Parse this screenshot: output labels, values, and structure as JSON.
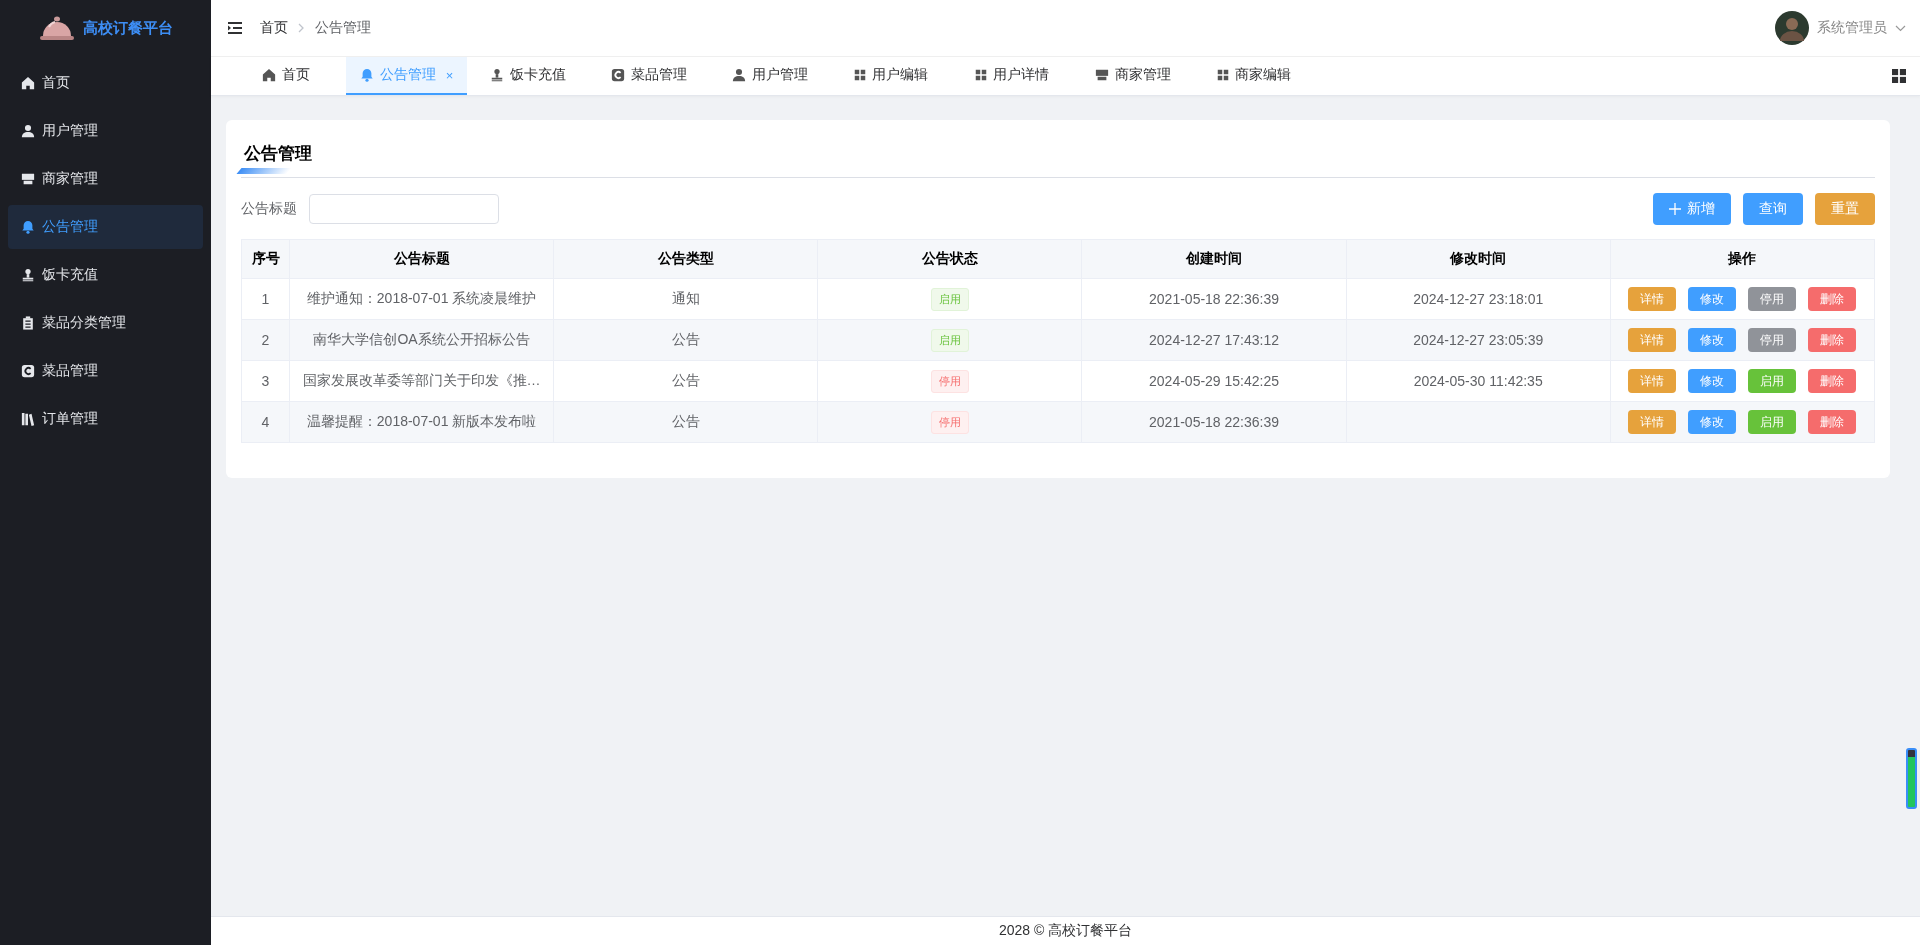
{
  "sidebar": {
    "brand": "高校订餐平台",
    "items": [
      {
        "label": "首页",
        "selected": false
      },
      {
        "label": "用户管理",
        "selected": false
      },
      {
        "label": "商家管理",
        "selected": false
      },
      {
        "label": "公告管理",
        "selected": true
      },
      {
        "label": "饭卡充值",
        "selected": false
      },
      {
        "label": "菜品分类管理",
        "selected": false
      },
      {
        "label": "菜品管理",
        "selected": false
      },
      {
        "label": "订单管理",
        "selected": false
      }
    ]
  },
  "header": {
    "breadcrumb": [
      "首页",
      "公告管理"
    ],
    "user_name": "系统管理员"
  },
  "tabs": [
    {
      "label": "首页",
      "selected": false
    },
    {
      "label": "公告管理",
      "selected": true,
      "close": "×"
    },
    {
      "label": "饭卡充值",
      "selected": false
    },
    {
      "label": "菜品管理",
      "selected": false
    },
    {
      "label": "用户管理",
      "selected": false
    },
    {
      "label": "用户编辑",
      "selected": false
    },
    {
      "label": "用户详情",
      "selected": false
    },
    {
      "label": "商家管理",
      "selected": false
    },
    {
      "label": "商家编辑",
      "selected": false
    }
  ],
  "panel": {
    "title": "公告管理",
    "search": {
      "label": "公告标题"
    },
    "buttons": [
      {
        "label": "新增",
        "kind": "add"
      },
      {
        "label": "查询",
        "kind": "query"
      },
      {
        "label": "重置",
        "kind": "reset"
      }
    ],
    "table": {
      "columns": [
        "序号",
        "公告标题",
        "公告类型",
        "公告状态",
        "创建时间",
        "修改时间",
        "操作"
      ],
      "rows": [
        {
          "index": "1",
          "title": "维护通知：2018-07-01 系统凌晨维护",
          "type": "通知",
          "status": {
            "label": "启用",
            "enabled": true
          },
          "created": "2021-05-18 22:36:39",
          "modified": "2024-12-27 23:18:01",
          "actions": [
            {
              "label": "详情",
              "kind": "detail"
            },
            {
              "label": "修改",
              "kind": "edit"
            },
            {
              "label": "停用",
              "kind": "disable"
            },
            {
              "label": "删除",
              "kind": "delete"
            }
          ]
        },
        {
          "index": "2",
          "title": "南华大学信创OA系统公开招标公告",
          "type": "公告",
          "status": {
            "label": "启用",
            "enabled": true
          },
          "created": "2024-12-27 17:43:12",
          "modified": "2024-12-27 23:05:39",
          "actions": [
            {
              "label": "详情",
              "kind": "detail"
            },
            {
              "label": "修改",
              "kind": "edit"
            },
            {
              "label": "停用",
              "kind": "disable"
            },
            {
              "label": "删除",
              "kind": "delete"
            }
          ]
        },
        {
          "index": "3",
          "title": "国家发展改革委等部门关于印发《推…",
          "type": "公告",
          "status": {
            "label": "停用",
            "enabled": false
          },
          "created": "2024-05-29 15:42:25",
          "modified": "2024-05-30 11:42:35",
          "actions": [
            {
              "label": "详情",
              "kind": "detail"
            },
            {
              "label": "修改",
              "kind": "edit"
            },
            {
              "label": "启用",
              "kind": "enable"
            },
            {
              "label": "删除",
              "kind": "delete"
            }
          ]
        },
        {
          "index": "4",
          "title": "温馨提醒：2018-07-01 新版本发布啦",
          "type": "公告",
          "status": {
            "label": "停用",
            "enabled": false
          },
          "created": "2021-05-18 22:36:39",
          "actions": [
            {
              "label": "详情",
              "kind": "detail"
            },
            {
              "label": "修改",
              "kind": "edit"
            },
            {
              "label": "启用",
              "kind": "enable"
            },
            {
              "label": "删除",
              "kind": "delete"
            }
          ]
        }
      ]
    }
  },
  "footer": "2028 © 高校订餐平台"
}
